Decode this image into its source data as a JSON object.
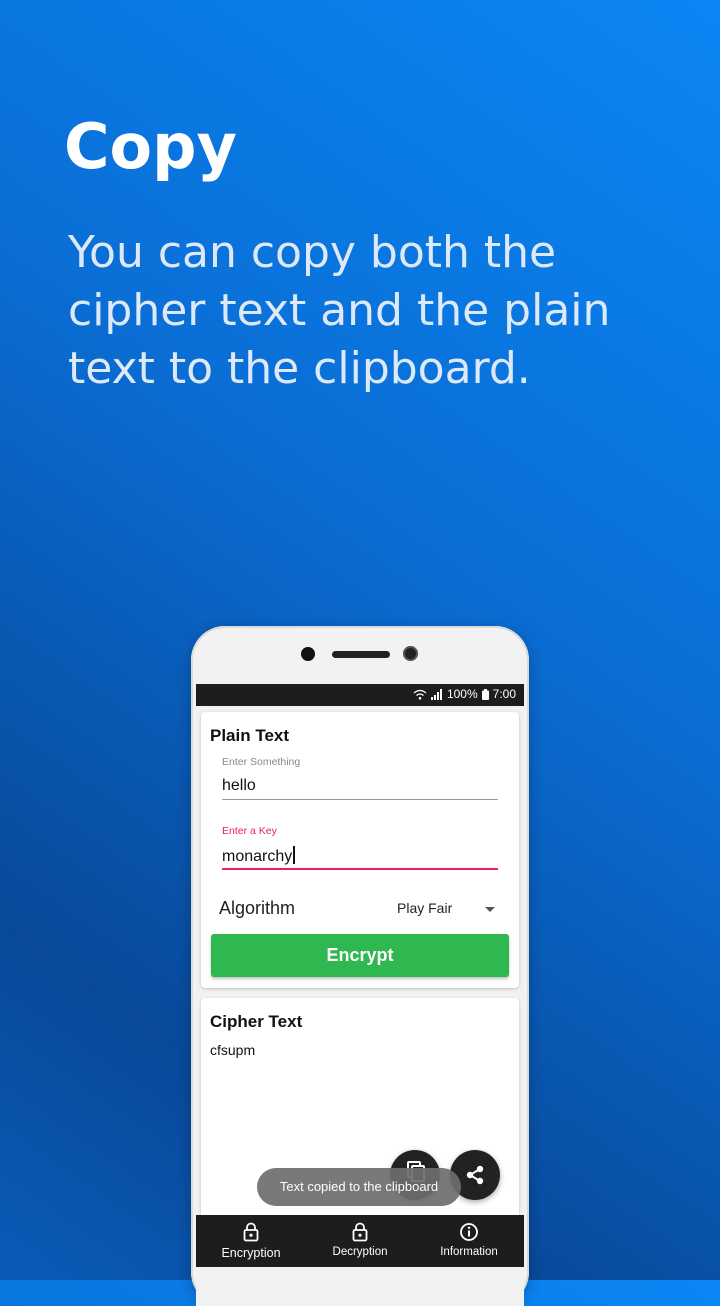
{
  "promo": {
    "title": "Copy",
    "description": "You can copy both the cipher text and the plain text to the clipboard."
  },
  "status_bar": {
    "battery": "100%",
    "time": "7:00"
  },
  "plain_card": {
    "title": "Plain Text",
    "text_label": "Enter Something",
    "text_value": "hello",
    "key_label": "Enter a Key",
    "key_value": "monarchy",
    "algorithm_label": "Algorithm",
    "algorithm_selected": "Play Fair",
    "encrypt_label": "Encrypt"
  },
  "cipher_card": {
    "title": "Cipher Text",
    "value": "cfsupm"
  },
  "toast": "Text copied to the clipboard",
  "bottom_nav": {
    "items": [
      {
        "label": "Encryption",
        "icon": "lock-icon",
        "active": true
      },
      {
        "label": "Decryption",
        "icon": "lock-icon",
        "active": false
      },
      {
        "label": "Information",
        "icon": "info-icon",
        "active": false
      }
    ]
  },
  "colors": {
    "accent_pink": "#e91e63",
    "button_green": "#2fb84f",
    "background_blue": "#0a6fd6"
  }
}
